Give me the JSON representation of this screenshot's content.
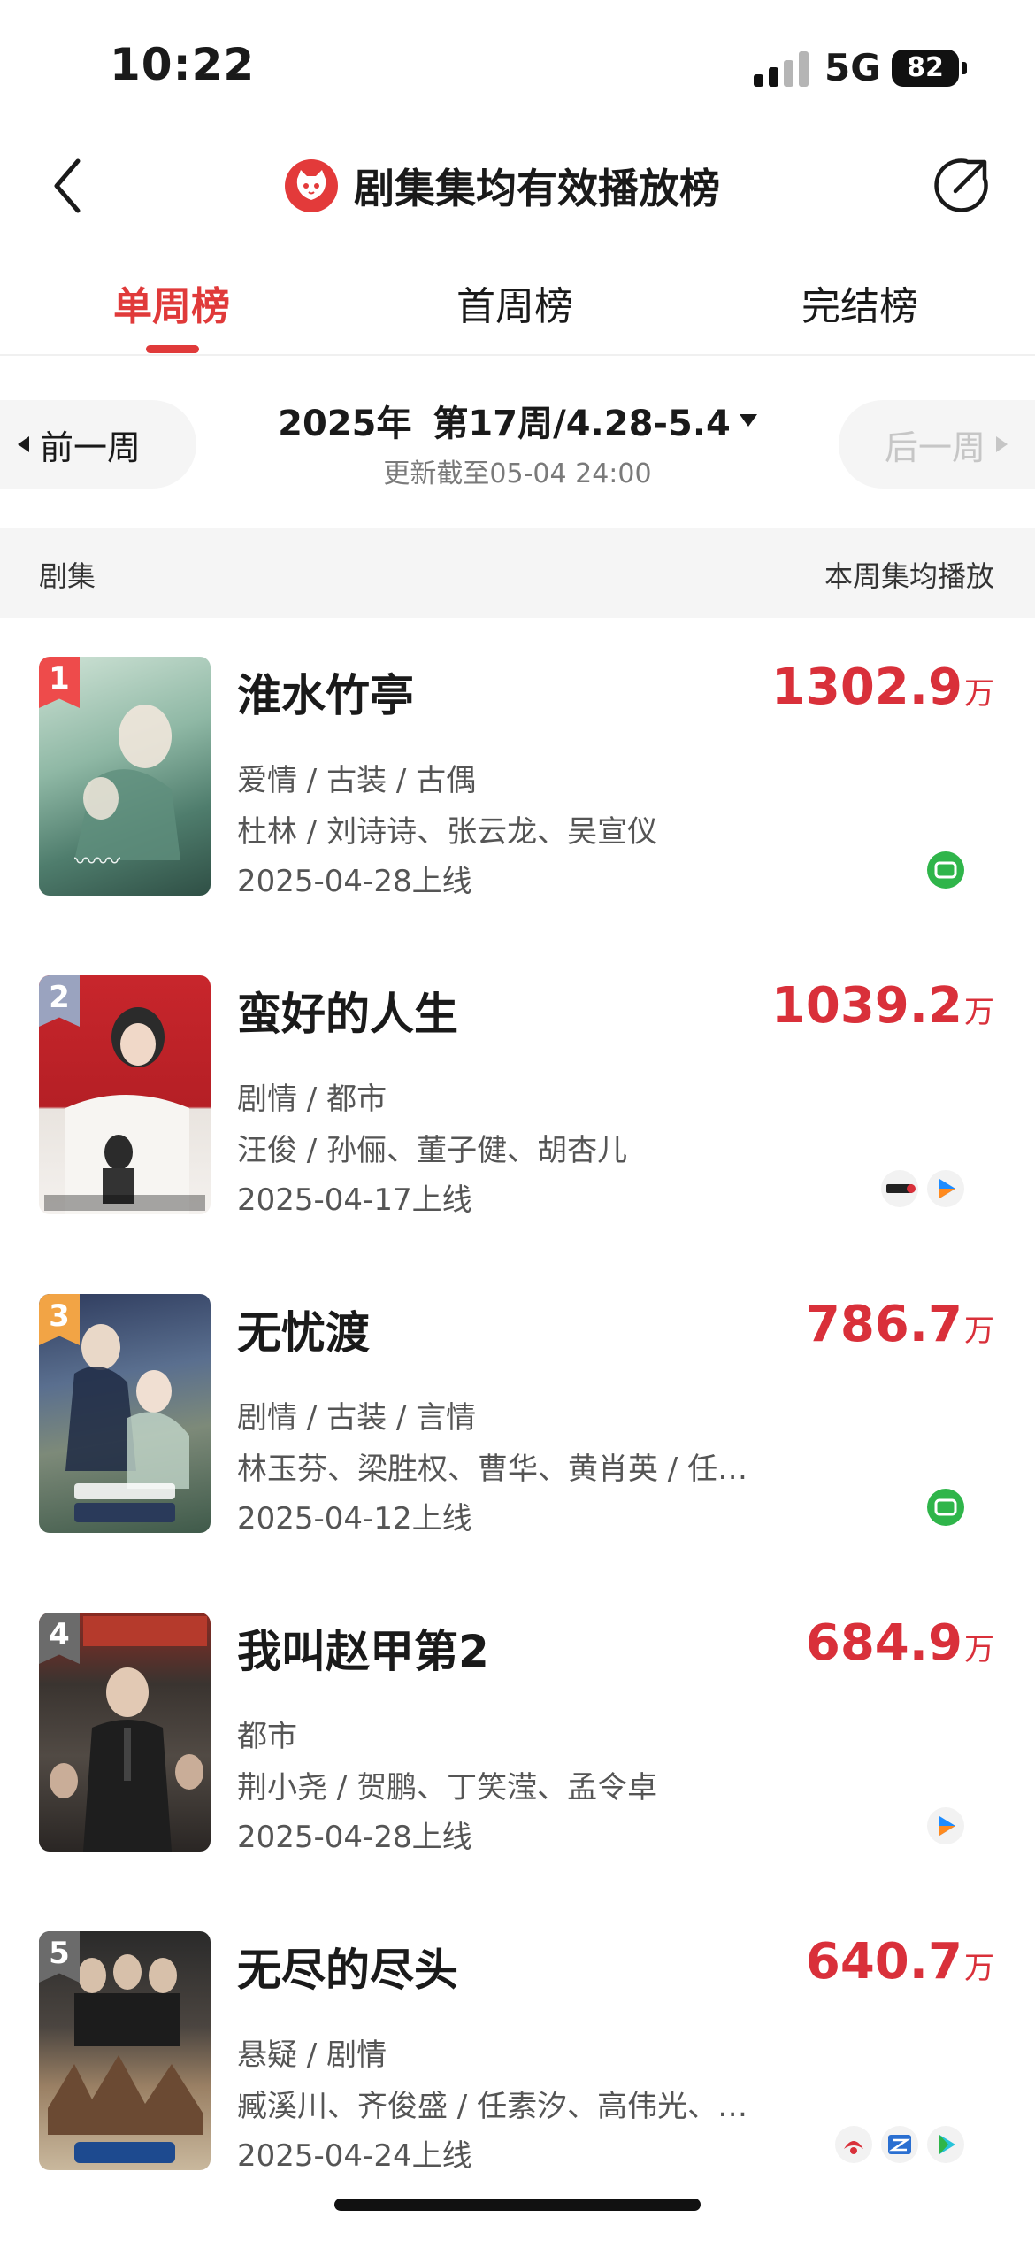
{
  "status_bar": {
    "time": "10:22",
    "network": "5G",
    "battery": "82"
  },
  "header": {
    "title": "剧集集均有效播放榜",
    "back_icon": "chevron-left-icon",
    "share_icon": "share-icon",
    "logo_color": "#e33a3a"
  },
  "tabs": [
    {
      "label": "单周榜",
      "active": true
    },
    {
      "label": "首周榜",
      "active": false
    },
    {
      "label": "完结榜",
      "active": false
    }
  ],
  "week_selector": {
    "prev": "前一周",
    "next": "后一周",
    "year": "2025年",
    "week": "第17周/4.28-5.4",
    "updated": "更新截至05-04  24:00"
  },
  "list_header": {
    "left": "剧集",
    "right": "本周集均播放"
  },
  "unit": "万",
  "colors": {
    "accent": "#e03a3a",
    "value": "#d9303a",
    "rank1": "#ee4b4b",
    "rank2": "#9aa3bf",
    "rank3": "#f2a445",
    "rank_other": "#6b6b6b"
  },
  "rows": [
    {
      "rank": "1",
      "title": "淮水竹亭",
      "plays": "1302.9",
      "genre": "爱情 / 古装 / 古偶",
      "cast": "杜林 / 刘诗诗、张云龙、吴宣仪",
      "date": "2025-04-28上线",
      "platforms": [
        "iqiyi-icon"
      ]
    },
    {
      "rank": "2",
      "title": "蛮好的人生",
      "plays": "1039.2",
      "genre": "剧情 / 都市",
      "cast": "汪俊 / 孙俪、董子健、胡杏儿",
      "date": "2025-04-17上线",
      "platforms": [
        "cctv-icon",
        "tencent-video-icon"
      ]
    },
    {
      "rank": "3",
      "title": "无忧渡",
      "plays": "786.7",
      "genre": "剧情 / 古装 / 言情",
      "cast": "林玉芬、梁胜权、曹华、黄肖英 / 任…",
      "date": "2025-04-12上线",
      "platforms": [
        "iqiyi-icon"
      ]
    },
    {
      "rank": "4",
      "title": "我叫赵甲第2",
      "plays": "684.9",
      "genre": "都市",
      "cast": "荆小尧 / 贺鹏、丁笑滢、孟令卓",
      "date": "2025-04-28上线",
      "platforms": [
        "tencent-video-icon"
      ]
    },
    {
      "rank": "5",
      "title": "无尽的尽头",
      "plays": "640.7",
      "genre": "悬疑 / 剧情",
      "cast": "臧溪川、齐俊盛 / 任素汐、高伟光、…",
      "date": "2025-04-24上线",
      "platforms": [
        "dragon-tv-icon",
        "zhejiang-tv-icon",
        "youku-icon"
      ]
    }
  ]
}
